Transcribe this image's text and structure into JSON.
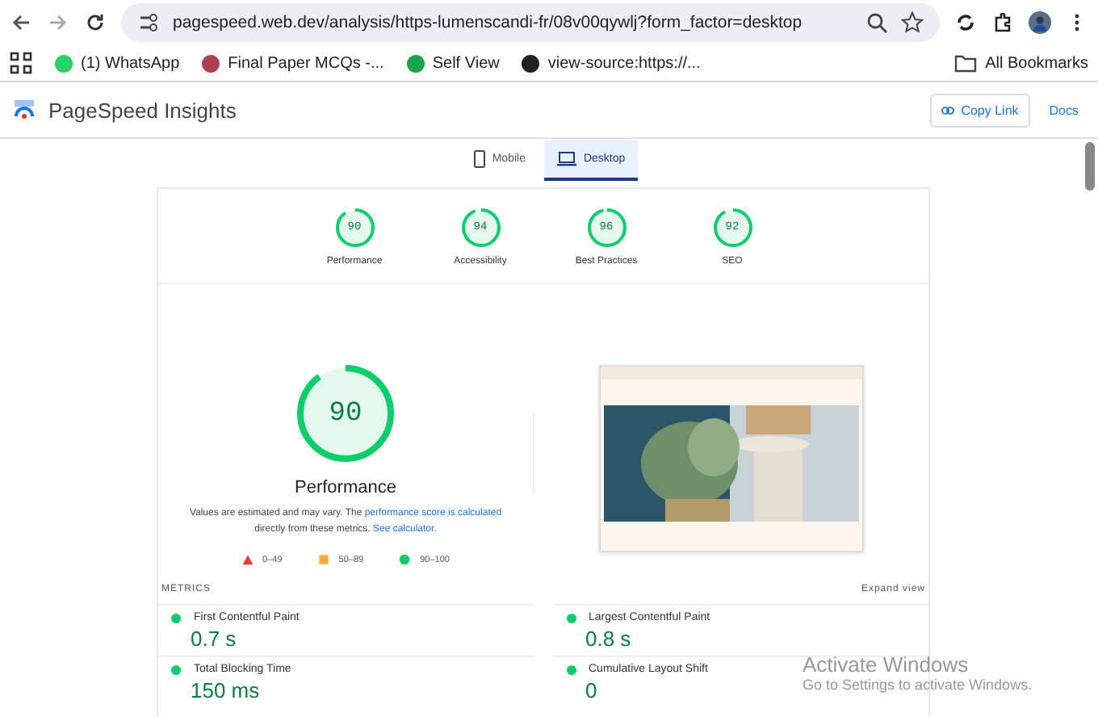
{
  "browser": {
    "url": "pagespeed.web.dev/analysis/https-lumenscandi-fr/08v00qywlj?form_factor=desktop",
    "bookmarks": [
      {
        "label": "(1) WhatsApp",
        "color": "#25d366"
      },
      {
        "label": "Final Paper MCQs -...",
        "color": "#b04050"
      },
      {
        "label": "Self View",
        "color": "#1aa34a"
      },
      {
        "label": "view-source:https://...",
        "color": "#202124"
      }
    ],
    "all_bookmarks": "All Bookmarks"
  },
  "app": {
    "title": "PageSpeed Insights",
    "copy_link": "Copy Link",
    "docs": "Docs"
  },
  "tabs": [
    {
      "label": "Mobile",
      "selected": false,
      "kind": "phone"
    },
    {
      "label": "Desktop",
      "selected": true,
      "kind": "laptop"
    }
  ],
  "scores": [
    {
      "score": "90",
      "level": 0.9,
      "label": "Performance"
    },
    {
      "score": "94",
      "level": 0.94,
      "label": "Accessibility"
    },
    {
      "score": "96",
      "level": 0.96,
      "label": "Best Practices"
    },
    {
      "score": "92",
      "level": 0.92,
      "label": "SEO"
    }
  ],
  "performance": {
    "score": "90",
    "level": 0.9,
    "title": "Performance",
    "note": "Values are estimated and may vary. The ",
    "link1": "performance score is calculated",
    "note2": " directly from these metrics. ",
    "link2": "See calculator.",
    "legend": [
      {
        "kind": "triangle",
        "label": "0–49",
        "color": "#ff3333"
      },
      {
        "kind": "square",
        "label": "50–89",
        "color": "#ffaa33"
      },
      {
        "kind": "circle",
        "label": "90–100",
        "color": "#0cce6b"
      }
    ]
  },
  "metrics": {
    "heading": "METRICS",
    "expand": "Expand view",
    "items": [
      {
        "name": "First Contentful Paint",
        "value": "0.7 s",
        "color": "#0cce6b"
      },
      {
        "name": "Largest Contentful Paint",
        "value": "0.8 s",
        "color": "#0cce6b"
      },
      {
        "name": "Total Blocking Time",
        "value": "150 ms",
        "color": "#0cce6b"
      },
      {
        "name": "Cumulative Layout Shift",
        "value": "0",
        "color": "#0cce6b"
      }
    ]
  },
  "activation": {
    "title": "Activate Windows",
    "subtitle": "Go to Settings to activate Windows."
  }
}
